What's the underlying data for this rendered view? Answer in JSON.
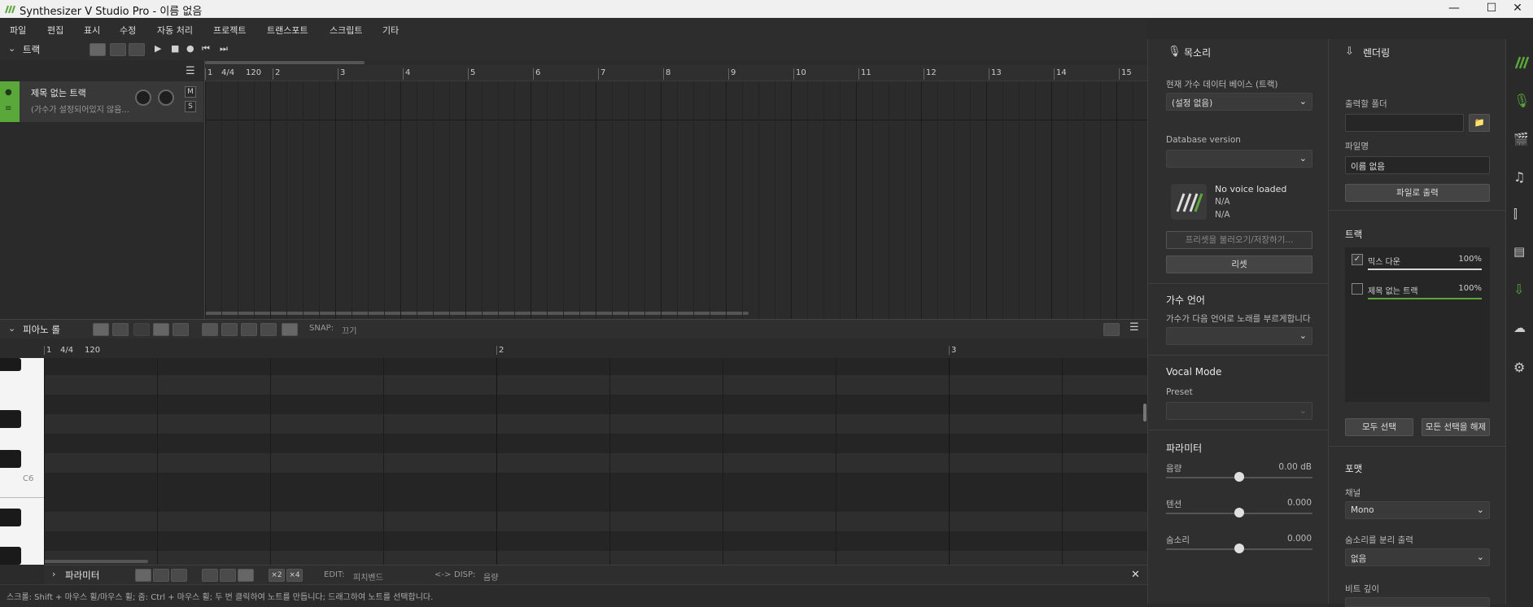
{
  "window": {
    "title": "Synthesizer V Studio Pro - 이름 없음",
    "minimize": "—",
    "maximize": "☐",
    "close": "✕"
  },
  "menu": [
    "파일",
    "편집",
    "표시",
    "수정",
    "자동 처리",
    "프로젝트",
    "트랜스포트",
    "스크립트",
    "기타"
  ],
  "track_panel": {
    "title": "트랙"
  },
  "track": {
    "name": "제목 없는 트랙",
    "subtitle": "(가수가 설정되어있지 않음...",
    "mute": "M",
    "solo": "S"
  },
  "arrange_ruler": {
    "time_sig": "4/4",
    "tempo": "120",
    "bars": [
      "1",
      "2",
      "3",
      "4",
      "5",
      "6",
      "7",
      "8",
      "9",
      "10",
      "11",
      "12",
      "13",
      "14",
      "15"
    ]
  },
  "piano_roll": {
    "title": "피아노 롤",
    "snap_label": "SNAP:",
    "snap_value": "끄기",
    "time_sig": "4/4",
    "tempo": "120",
    "bars": [
      "1",
      "2",
      "3"
    ],
    "c6_label": "C6"
  },
  "param_bar": {
    "title": "파라미터",
    "x2": "×2",
    "x4": "×4",
    "edit_label": "EDIT:",
    "edit_value": "피치벤드",
    "disp_label": "DISP:",
    "disp_value": "음량",
    "arrows": "<->",
    "close": "✕"
  },
  "status": {
    "text": "스크롤: Shift + 마우스 휠/마우스 휠; 줌: Ctrl + 마우스 휠; 두 번 클릭하여 노트를 만듭니다; 드래그하여 노트를 선택합니다."
  },
  "voice_panel": {
    "title": "목소리",
    "db_label": "현재 가수 데이터 베이스 (트랙)",
    "db_value": "(설정 없음)",
    "dbver_label": "Database version",
    "dbver_value": "",
    "voice_name": "No voice loaded",
    "na1": "N/A",
    "na2": "N/A",
    "preset_btn": "프리셋을 불러오기/저장하기...",
    "reset_btn": "리셋",
    "lang_title": "가수 언어",
    "lang_label": "가수가 다음 언어로 노래를 부르게합니다",
    "lang_value": "",
    "vocal_mode_title": "Vocal Mode",
    "preset_label": "Preset",
    "preset_value": "",
    "param_title": "파라미터",
    "params": [
      {
        "name": "음량",
        "value": "0.00 dB",
        "level": 0.5
      },
      {
        "name": "텐션",
        "value": "0.000",
        "level": 0.5
      },
      {
        "name": "숨소리",
        "value": "0.000",
        "level": 0.5
      }
    ]
  },
  "render_panel": {
    "title": "렌더링",
    "folder_label": "출력할 폴더",
    "folder_value": "",
    "filename_label": "파일명",
    "filename_value": "이름 없음",
    "export_btn": "파일로 출력",
    "tracks_title": "트랙",
    "tracks": [
      {
        "name": "믹스 다운",
        "pct": "100%",
        "checked": true,
        "color": "#d8d8d8"
      },
      {
        "name": "제목 없는 트랙",
        "pct": "100%",
        "checked": false,
        "color": "#5aa83a"
      }
    ],
    "select_all": "모두 선택",
    "deselect_all": "모든 선택을 해제",
    "format_title": "포맷",
    "channel_label": "채널",
    "channel_value": "Mono",
    "split_label": "숨소리를 분리 출력",
    "split_value": "없음",
    "bitdepth_label": "비트 깊이"
  },
  "colors": {
    "accent": "#5aa83a"
  },
  "sidebar_icons": [
    "logo-icon",
    "microphone-icon",
    "clapperboard-icon",
    "music-note-icon",
    "library-icon",
    "book-icon",
    "render-icon",
    "cloud-check-icon",
    "gear-icon"
  ]
}
